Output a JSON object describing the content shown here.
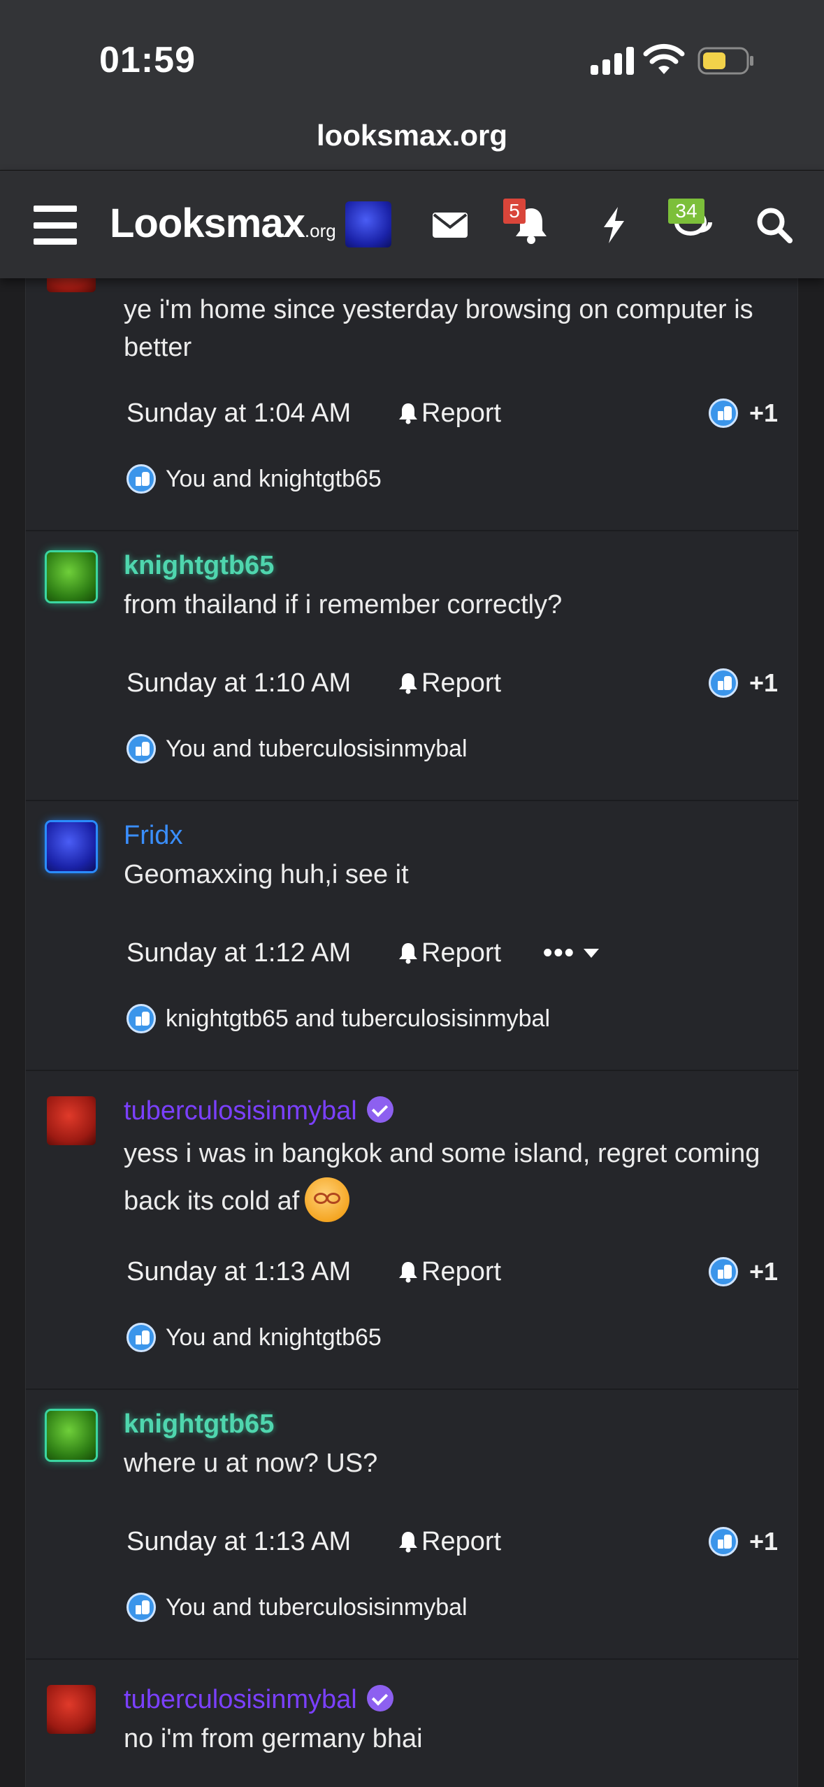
{
  "status_bar": {
    "time": "01:59",
    "url": "looksmax.org"
  },
  "nav": {
    "logo_main": "Looksmax",
    "logo_suffix": ".org",
    "alerts_badge": "5",
    "conversations_badge": "34"
  },
  "posts": [
    {
      "username": "",
      "message": "ye i'm home since yesterday browsing on computer is better",
      "timestamp": "Sunday at 1:04 AM",
      "report_label": "Report",
      "reaction_count": "+1",
      "likes_text": "You and knightgtb65"
    },
    {
      "username": "knightgtb65",
      "message": "from thailand if i remember correctly?",
      "timestamp": "Sunday at 1:10 AM",
      "report_label": "Report",
      "reaction_count": "+1",
      "likes_text": "You and tuberculosisinmybal"
    },
    {
      "username": "Fridx",
      "message": "Geomaxxing huh,i see it",
      "timestamp": "Sunday at 1:12 AM",
      "report_label": "Report",
      "more_label": "•••",
      "likes_text": "knightgtb65 and tuberculosisinmybal"
    },
    {
      "username": "tuberculosisinmybal",
      "message": "yess i was in bangkok and some island, regret coming back its cold af",
      "timestamp": "Sunday at 1:13 AM",
      "report_label": "Report",
      "reaction_count": "+1",
      "likes_text": "You and knightgtb65"
    },
    {
      "username": "knightgtb65",
      "message": "where u at now? US?",
      "timestamp": "Sunday at 1:13 AM",
      "report_label": "Report",
      "reaction_count": "+1",
      "likes_text": "You and tuberculosisinmybal"
    },
    {
      "username": "tuberculosisinmybal",
      "message": "no i'm from germany bhai"
    }
  ],
  "colors": {
    "background": "#1e1e20",
    "post_bg": "#25262a",
    "username_green": "#4fd6ae",
    "username_blue": "#3a8fff",
    "username_purple": "#7b40ff",
    "like_blue": "#3b95ea",
    "alert_badge": "#d9453a",
    "conversation_badge": "#7cbf3a"
  }
}
